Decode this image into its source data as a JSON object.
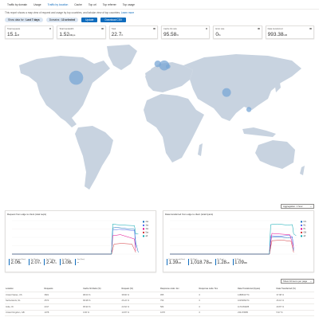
{
  "tabs": [
    {
      "label": "Traffic by domain",
      "active": false
    },
    {
      "label": "Usage",
      "active": false
    },
    {
      "label": "Traffic by location",
      "active": true
    },
    {
      "label": "Cache",
      "active": false
    },
    {
      "label": "Top url",
      "active": false
    },
    {
      "label": "Top referrer",
      "active": false
    },
    {
      "label": "Top usage",
      "active": false
    }
  ],
  "description": {
    "text": "This report shows a map view of request and usage by top countries, and tabular view of top countries.",
    "link": "Learn more"
  },
  "filters": {
    "date_label": "Show data for :",
    "date_value": "Last 7 days",
    "domains_label": "Domains :",
    "domains_value": "13 selected",
    "apply_label": "Update",
    "download_label": "Download CSV"
  },
  "kpis": [
    {
      "label": "Total requests",
      "value": "15.1",
      "unit": "M"
    },
    {
      "label": "Total bandwidth",
      "value": "1.52",
      "unit": "Mbps"
    },
    {
      "label": "Total",
      "value": "22.7",
      "unit": "K"
    },
    {
      "label": "Cache hit ratio",
      "value": "95.58",
      "unit": "%"
    },
    {
      "label": "Error rate",
      "value": "0",
      "unit": "%"
    },
    {
      "label": "Data transferred",
      "value": "993.38",
      "unit": "GB"
    }
  ],
  "map": {
    "land_color": "#c8d3e0",
    "bubble_color": "#7aa7d6",
    "bubbles": [
      {
        "country": "United States",
        "lon": -97,
        "lat": 38,
        "size": 4.2
      },
      {
        "country": "United Kingdom",
        "lon": -2,
        "lat": 54,
        "size": 2.0
      },
      {
        "country": "Netherlands",
        "lon": 5.5,
        "lat": 52.2,
        "size": 3.0
      },
      {
        "country": "Germany",
        "lon": 10,
        "lat": 51,
        "size": 1.4
      },
      {
        "country": "India",
        "lon": 78,
        "lat": 21,
        "size": 2.6
      },
      {
        "country": "Singapore",
        "lon": 104,
        "lat": 1.3,
        "size": 1.5
      }
    ]
  },
  "aggregation": {
    "label": "Aggregation: 1 hour"
  },
  "charts": [
    {
      "title": "Request from edge to client (total req/s)",
      "legend": [
        {
          "label": "2xx",
          "color": "#0f6cbd"
        },
        {
          "label": "3xx",
          "color": "#4f6bed"
        },
        {
          "label": "4xx",
          "color": "#e3008c"
        },
        {
          "label": "5xx",
          "color": "#d13438"
        },
        {
          "label": "all",
          "color": "#00a5af"
        }
      ],
      "summaries": [
        {
          "label": "Total requests (Sum)",
          "value": "2.06",
          "unit": "k"
        },
        {
          "label": "2xx (Sum)",
          "value": "2.07",
          "unit": "k"
        },
        {
          "label": "3xx (Sum)",
          "value": "2.47",
          "unit": "k"
        },
        {
          "label": "4xx (Sum)",
          "value": "1.08",
          "unit": "k"
        },
        {
          "label": "5xx (Sum)",
          "value": "-",
          "unit": ""
        }
      ]
    },
    {
      "title": "Data transferred from edge to client (total byte/s)",
      "legend": [
        {
          "label": "US",
          "color": "#0f6cbd"
        },
        {
          "label": "NL",
          "color": "#4f6bed"
        },
        {
          "label": "IN",
          "color": "#e3008c"
        },
        {
          "label": "GB",
          "color": "#d13438"
        },
        {
          "label": "all",
          "color": "#00a5af"
        }
      ],
      "summaries": [
        {
          "label": "Data transferred (Sum)",
          "value": "1.39",
          "unit": "GB"
        },
        {
          "label": "US (Sum)",
          "value": "1,018.78",
          "unit": "MB"
        },
        {
          "label": "NL (Sum)",
          "value": "1.28",
          "unit": "GB"
        },
        {
          "label": "IN (Sum)",
          "value": "1.09",
          "unit": "MB"
        }
      ]
    }
  ],
  "column_selector": {
    "label": "Show 10 items per page"
  },
  "table": {
    "headers": [
      "Location",
      "Requests",
      "Cache hit Ratio (%)",
      "Request (%)",
      "Response code: 4xx",
      "Response code: 5xx",
      "Data Transferred (bytes)",
      "Data Transferred (%)"
    ],
    "rows": [
      [
        "United States, US",
        "3821",
        "98.00 %",
        "38.82 %",
        "955",
        "0",
        "1488610774",
        "37.98 %"
      ],
      [
        "Netherlands, NL",
        "2573",
        "99.98 %",
        "26.22 %",
        "753",
        "0",
        "1025483274",
        "26.16 %"
      ],
      [
        "India, IN",
        "2317",
        "95.90 %",
        "23.62 %",
        "582",
        "0",
        "1171069485",
        "29.87 %"
      ],
      [
        "United Kingdom, GB",
        "1078",
        "0.00 %",
        "10.87 %",
        "1078",
        "0",
        "234179585",
        "5.97 %"
      ]
    ]
  }
}
